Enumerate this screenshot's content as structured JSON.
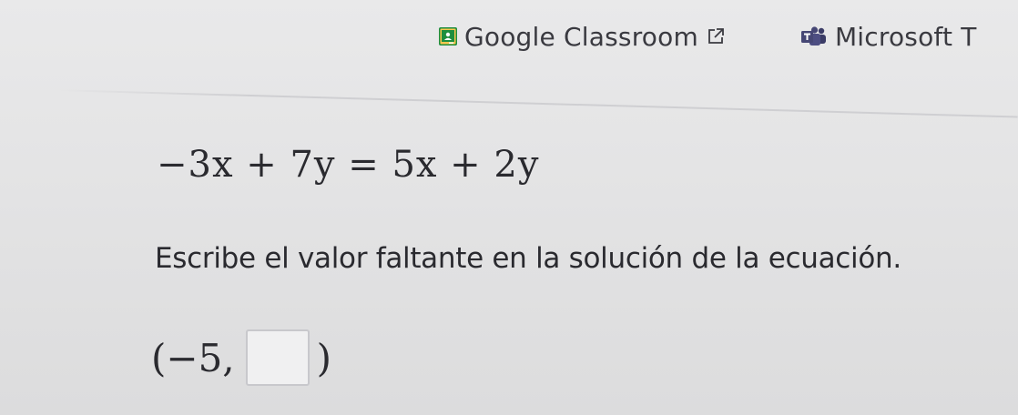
{
  "share": {
    "classroom_label": "Google Classroom",
    "teams_label": "Microsoft T"
  },
  "icons": {
    "classroom": "google-classroom-icon",
    "external": "external-link-icon",
    "teams": "microsoft-teams-icon"
  },
  "colors": {
    "classroom_green": "#1e8e3e",
    "classroom_yellow": "#f9c74f",
    "teams_purple": "#464775",
    "text": "#2a2a2f"
  },
  "problem": {
    "equation": "−3x + 7y = 5x + 2y",
    "instruction": "Escribe el valor faltante en la solución de la ecuación.",
    "answer_open": "(−5,",
    "answer_value": "",
    "answer_close": ")"
  }
}
